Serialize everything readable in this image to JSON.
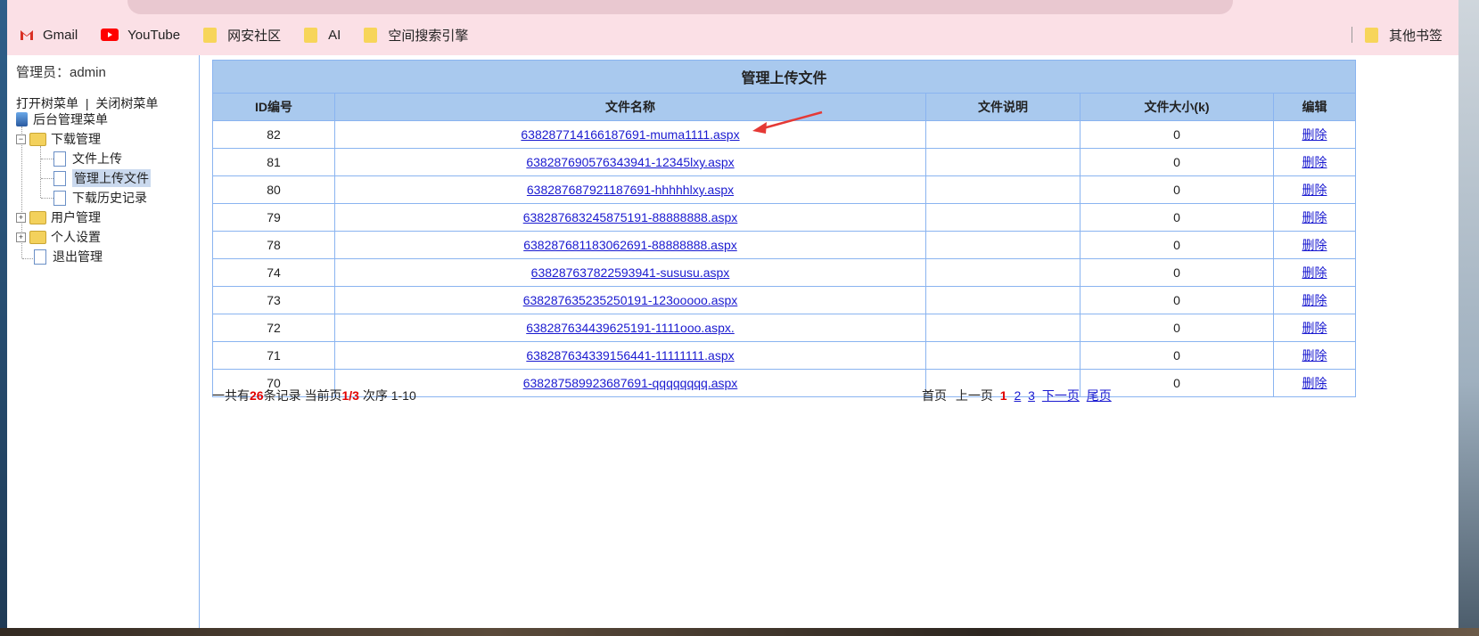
{
  "bookmarks": [
    {
      "label": "Gmail",
      "icon": "gmail-icon"
    },
    {
      "label": "YouTube",
      "icon": "youtube-icon"
    },
    {
      "label": "网安社区",
      "icon": "folder-icon"
    },
    {
      "label": "AI",
      "icon": "folder-icon"
    },
    {
      "label": "空间搜索引擎",
      "icon": "folder-icon"
    }
  ],
  "bookmarks_other": "其他书签",
  "sidebar": {
    "admin": "管理员：admin",
    "open_tree": "打开树菜单",
    "separator": "|",
    "close_tree": "关闭树菜单",
    "root": "后台管理菜单",
    "download": "下载管理",
    "upload": "文件上传",
    "manage_upload": "管理上传文件",
    "history": "下载历史记录",
    "users": "用户管理",
    "personal": "个人设置",
    "logout": "退出管理"
  },
  "table": {
    "caption": "管理上传文件",
    "columns": [
      "ID编号",
      "文件名称",
      "文件说明",
      "文件大小(k)",
      "编辑"
    ],
    "rows": [
      {
        "id": "82",
        "name": "638287714166187691-muma1111.aspx",
        "desc": "",
        "size": "0",
        "action": "删除"
      },
      {
        "id": "81",
        "name": "638287690576343941-12345lxy.aspx",
        "desc": "",
        "size": "0",
        "action": "删除"
      },
      {
        "id": "80",
        "name": "638287687921187691-hhhhhlxy.aspx",
        "desc": "",
        "size": "0",
        "action": "删除"
      },
      {
        "id": "79",
        "name": "638287683245875191-88888888.aspx",
        "desc": "",
        "size": "0",
        "action": "删除"
      },
      {
        "id": "78",
        "name": "638287681183062691-88888888.aspx",
        "desc": "",
        "size": "0",
        "action": "删除"
      },
      {
        "id": "74",
        "name": "638287637822593941-sususu.aspx",
        "desc": "",
        "size": "0",
        "action": "删除"
      },
      {
        "id": "73",
        "name": "638287635235250191-123ooooo.aspx",
        "desc": "",
        "size": "0",
        "action": "删除"
      },
      {
        "id": "72",
        "name": "638287634439625191-1111ooo.aspx.",
        "desc": "",
        "size": "0",
        "action": "删除"
      },
      {
        "id": "71",
        "name": "638287634339156441-11111111.aspx",
        "desc": "",
        "size": "0",
        "action": "删除"
      },
      {
        "id": "70",
        "name": "638287589923687691-qqqqqqqq.aspx",
        "desc": "",
        "size": "0",
        "action": "删除"
      }
    ]
  },
  "pager": {
    "total_prefix": "一共有",
    "total": "26",
    "total_suffix": "条记录 当前页",
    "current": "1/3",
    "range": " 次序 1-10",
    "first": "首页",
    "prev": "上一页",
    "pages": [
      "1",
      "2",
      "3"
    ],
    "next": "下一页",
    "last": "尾页"
  },
  "colors": {
    "accent": "#a9c9ee",
    "border": "#8ab4f0",
    "link": "#1a1ad0",
    "highlight": "#e00000"
  }
}
